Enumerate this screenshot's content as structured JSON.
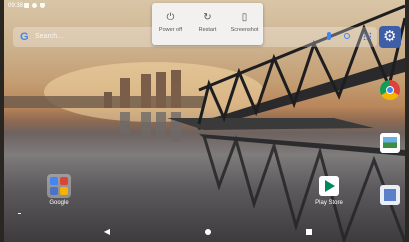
{
  "status_bar": {
    "time": "09:38",
    "icons": [
      "message-icon",
      "settings-status-icon",
      "shield-icon"
    ]
  },
  "search": {
    "google_g": "G",
    "placeholder": "Search..."
  },
  "power_menu": {
    "items": [
      {
        "label": "Power off",
        "icon": "power-icon",
        "glyph": "⏻"
      },
      {
        "label": "Restart",
        "icon": "restart-icon",
        "glyph": "↻"
      },
      {
        "label": "Screenshot",
        "icon": "screenshot-icon",
        "glyph": "▯"
      }
    ]
  },
  "home": {
    "folder_label": "Google",
    "playstore_label": "Play Store"
  },
  "dock": [
    "settings-app-icon",
    "chrome-icon",
    "gallery-icon",
    "files-icon"
  ],
  "nav": {
    "back": "◀"
  },
  "colors": {
    "google_blue": "#4285F4",
    "settings_bg": "#3f5ea8",
    "power_menu_bg": "#f3f1ef"
  }
}
